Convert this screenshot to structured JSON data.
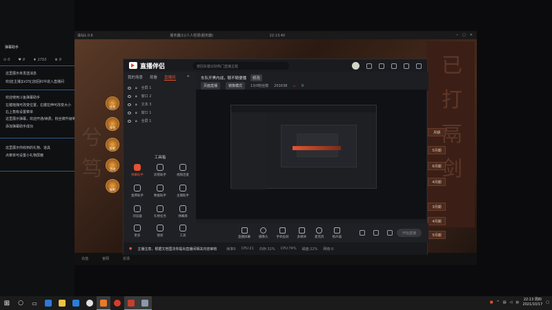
{
  "chat": {
    "header": "弹幕助手",
    "stats": [
      "0",
      "0",
      "1710",
      "0"
    ],
    "lines": [
      {
        "text": "这里展示未发送消息",
        "color": "#bfc5cc"
      },
      {
        "text": "欢迎[主播]LV25[]加回红中进入直播间",
        "color": "#bfc5cc",
        "highlight": "[主播]LV25[]"
      },
      {
        "text": "欢迎使用斗鱼弹幕助手",
        "color": "#bfc5cc"
      },
      {
        "text": "左键拖拽可改变位置，右键拉伸可改变大小",
        "color": "#bfc5cc"
      },
      {
        "text": "右上角有设置菜单",
        "color": "#bfc5cc"
      },
      {
        "text": "这里展示弹幕，欢迎开通/续费，粉丝牌升级等",
        "color": "#bfc5cc"
      },
      {
        "text": "添加弹幕助手成功",
        "color": "#bfc5cc"
      },
      {
        "text": "这里展示你收到的礼物、道具",
        "color": "#bfc5cc"
      },
      {
        "text": "点菜单可设置小礼物屏蔽",
        "color": "#bfc5cc"
      }
    ]
  },
  "game": {
    "title": "诛仙1.0.6",
    "title2": "服务器(1)/人人轻便(服务器)",
    "time": "22:13:40",
    "bottom": [
      "充值",
      "官网",
      "反馈"
    ],
    "menu": [
      "任务",
      "背包",
      "技能",
      "活动",
      "福利"
    ],
    "rpanel": [
      "月期",
      "5月期",
      "6月期",
      "4月期",
      "3月期",
      "4月期",
      "5月期"
    ]
  },
  "broadcast": {
    "logo": "直播伴侣",
    "search": "按回车键识别热门直播主题",
    "tabs": [
      "我的场景",
      "观看",
      "直播间"
    ],
    "scenes": [
      "全屏 1",
      "窗口 2",
      "文本 3",
      "窗口 1",
      "全屏 1"
    ],
    "tools_title": "工具箱",
    "tools": [
      "弹幕助手",
      "房管助手",
      "视频连麦",
      "金牌助手",
      "数据助手",
      "主播助手",
      "浏览器",
      "礼物任务",
      "弹幕库",
      "更多",
      "搜索",
      "工具"
    ],
    "stream_title": "车队开黑内战，随不随便播",
    "edit_label": "修改",
    "chip1": "页面直播",
    "chip2": "镜像模式",
    "room_info": "13/0粉丝数",
    "room_id": "201638",
    "likes": "0",
    "controls": [
      "直播屏幕",
      "摄像头",
      "手机投屏",
      "多媒体",
      "麦克风",
      "扬声器"
    ],
    "start_label": "开始直播",
    "status_warn": "主播注意，根据文管国法你提出直播间相关内容审核",
    "status_items": [
      "帧率0",
      "CPU:21",
      "内存:32%",
      "CPU:74%",
      "磁盘:22%",
      "网络:0"
    ]
  },
  "taskbar": {
    "time": "22:13 周四",
    "date": "2021/10/17"
  }
}
